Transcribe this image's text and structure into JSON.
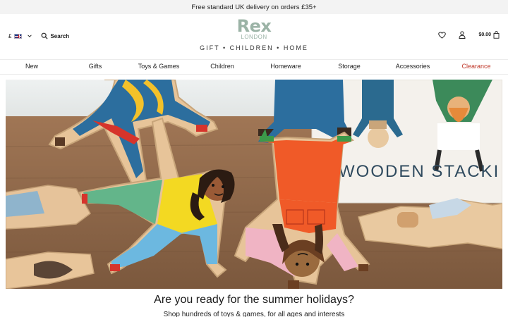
{
  "promo": {
    "text": "Free standard UK delivery on orders £35+"
  },
  "header": {
    "currency": "£",
    "search_label": "Search",
    "logo_main": "Rex",
    "logo_sub": "LONDON",
    "tagline": "GIFT • CHILDREN • HOME",
    "cart_total": "$0.00"
  },
  "nav": {
    "items": [
      {
        "label": "New"
      },
      {
        "label": "Gifts"
      },
      {
        "label": "Toys & Games"
      },
      {
        "label": "Children"
      },
      {
        "label": "Homeware"
      },
      {
        "label": "Storage"
      },
      {
        "label": "Accessories"
      },
      {
        "label": "Clearance"
      }
    ]
  },
  "hero": {
    "box_text": "WOODEN STACKI"
  },
  "caption": {
    "heading": "Are you ready for the summer holidays?",
    "subheading": "Shop hundreds of toys & games, for all ages and interests"
  },
  "colors": {
    "brand": "#9bb3a6",
    "clearance": "#c0392b",
    "promo_bg": "#f3f3f3"
  }
}
